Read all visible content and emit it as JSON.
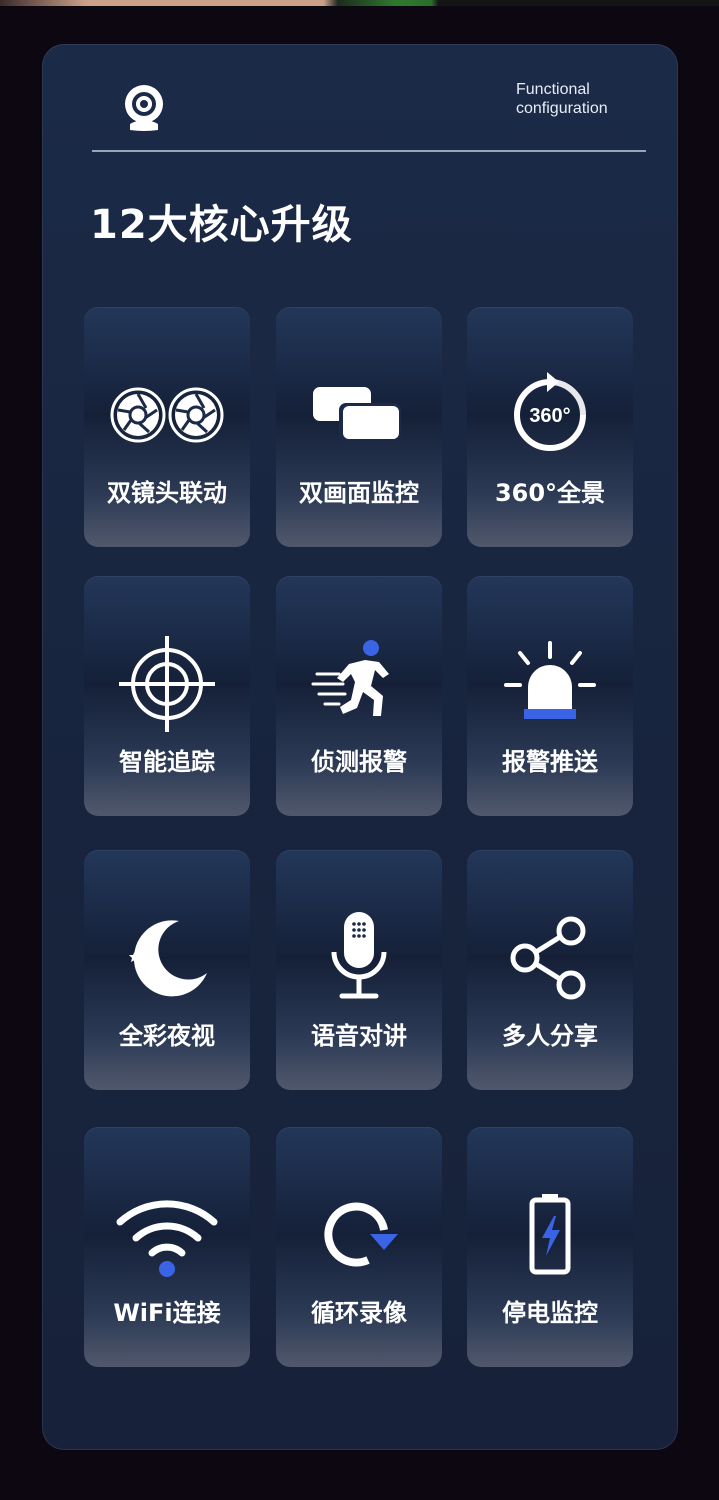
{
  "header": {
    "icon": "webcam-icon",
    "text_line1": "Functional",
    "text_line2": "configuration"
  },
  "title": "12大核心升级",
  "accent_color": "#3b63e6",
  "features": [
    {
      "label": "双镜头联动",
      "icon": "dual-lens-icon"
    },
    {
      "label": "双画面监控",
      "icon": "dual-screen-icon"
    },
    {
      "label": "360°全景",
      "icon": "panorama-360-icon"
    },
    {
      "label": "智能追踪",
      "icon": "crosshair-icon"
    },
    {
      "label": "侦测报警",
      "icon": "running-person-icon"
    },
    {
      "label": "报警推送",
      "icon": "alarm-light-icon"
    },
    {
      "label": "全彩夜视",
      "icon": "moon-stars-icon"
    },
    {
      "label": "语音对讲",
      "icon": "microphone-icon"
    },
    {
      "label": "多人分享",
      "icon": "share-icon"
    },
    {
      "label": "WiFi连接",
      "icon": "wifi-icon"
    },
    {
      "label": "循环录像",
      "icon": "loop-record-icon"
    },
    {
      "label": "停电监控",
      "icon": "battery-icon"
    }
  ],
  "panorama_badge": "360°"
}
